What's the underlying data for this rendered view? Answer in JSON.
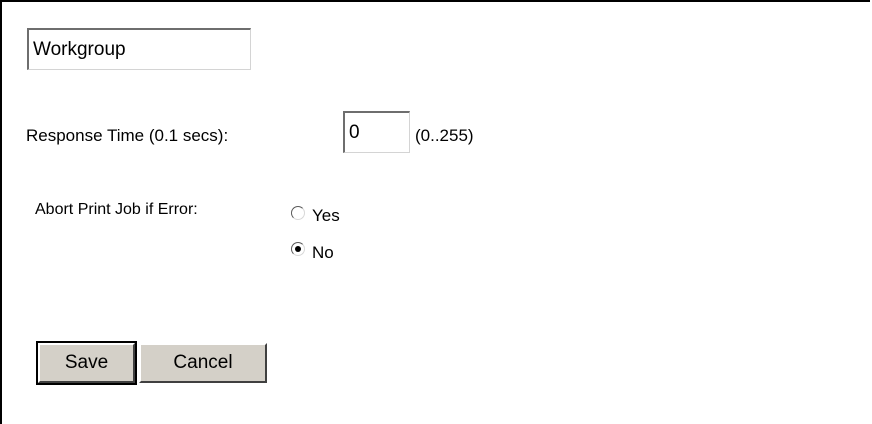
{
  "form": {
    "workgroup_value": "Workgroup",
    "response_time_label": "Response Time (0.1 secs):",
    "response_time_value": "0",
    "response_time_range": "(0..255)",
    "abort_label": "Abort Print Job if Error:",
    "abort_options": [
      {
        "label": "Yes",
        "checked": false
      },
      {
        "label": "No",
        "checked": true
      }
    ],
    "save_label": "Save",
    "cancel_label": "Cancel"
  },
  "icons": {
    "radio_yes": "radio-unchecked-icon",
    "radio_no": "radio-checked-icon"
  }
}
